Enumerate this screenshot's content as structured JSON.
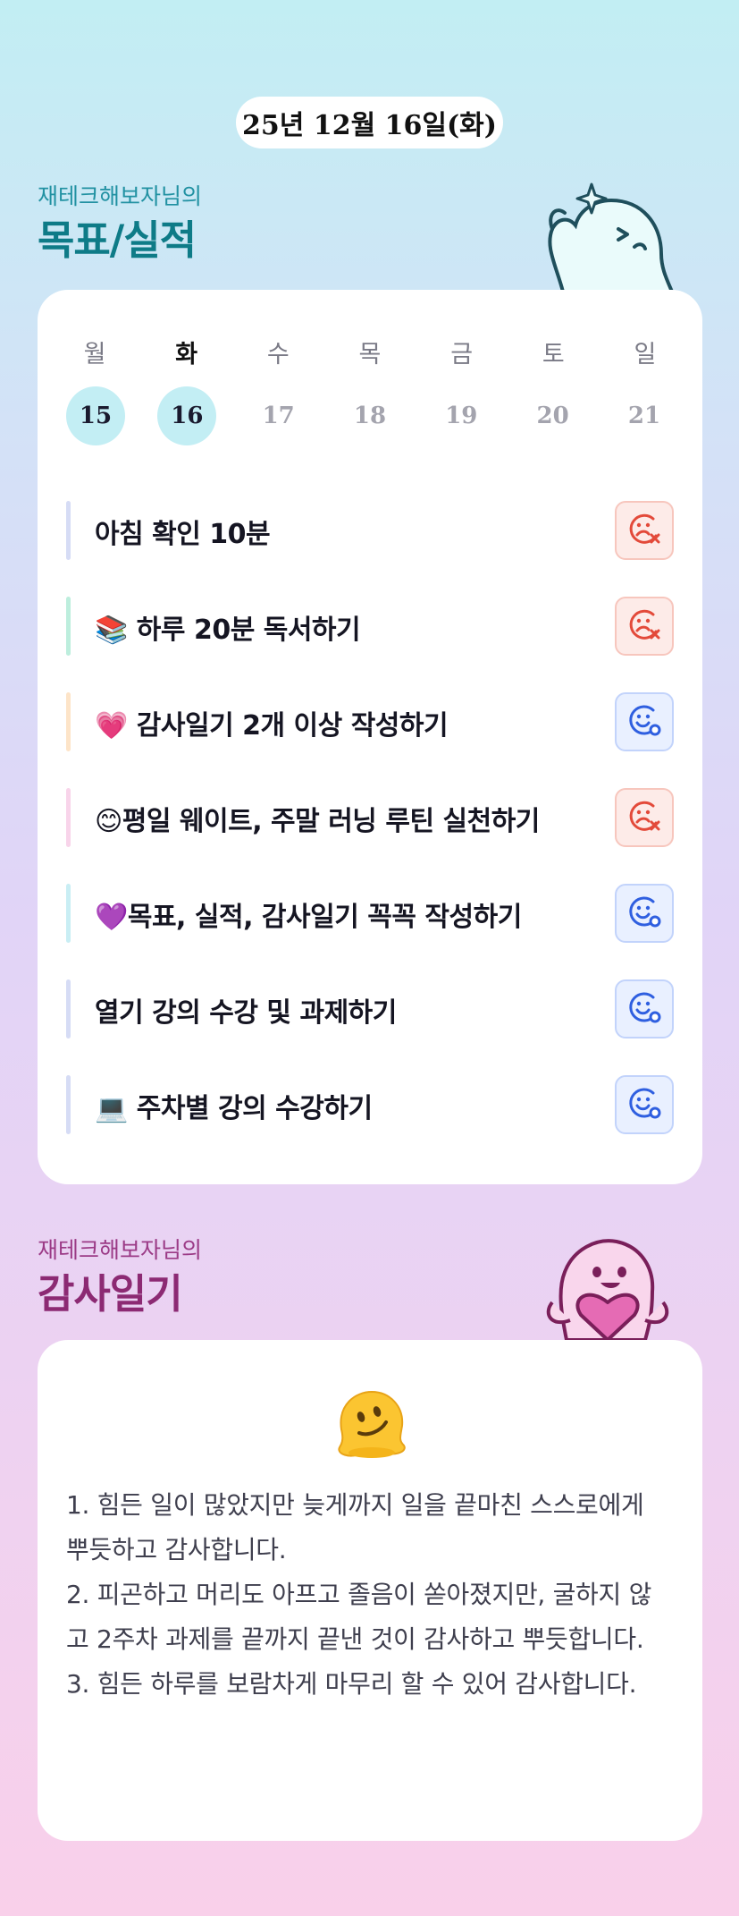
{
  "header": {
    "date": "25년 12월 16일(화)"
  },
  "goals_section": {
    "subtitle": "재테크해보자님의",
    "title": "목표/실적"
  },
  "week": {
    "days": [
      {
        "label": "월",
        "date": "15",
        "today": false,
        "active": true
      },
      {
        "label": "화",
        "date": "16",
        "today": true,
        "active": true
      },
      {
        "label": "수",
        "date": "17",
        "today": false,
        "active": false
      },
      {
        "label": "목",
        "date": "18",
        "today": false,
        "active": false
      },
      {
        "label": "금",
        "date": "19",
        "today": false,
        "active": false
      },
      {
        "label": "토",
        "date": "20",
        "today": false,
        "active": false
      },
      {
        "label": "일",
        "date": "21",
        "today": false,
        "active": false
      }
    ]
  },
  "goals": [
    {
      "text": "아침 확인 10분",
      "status": "fail",
      "status_icon": "sad-face-x-icon",
      "bar_color": "#d6dcf5"
    },
    {
      "text": "📚 하루 20분 독서하기",
      "status": "fail",
      "status_icon": "sad-face-x-icon",
      "bar_color": "#bdeedd"
    },
    {
      "text": "💗 감사일기 2개 이상 작성하기",
      "status": "done",
      "status_icon": "smile-face-check-icon",
      "bar_color": "#fde4c8"
    },
    {
      "text": "😊평일 웨이트, 주말 러닝 루틴 실천하기",
      "status": "fail",
      "status_icon": "sad-face-x-icon",
      "bar_color": "#f8d4ea"
    },
    {
      "text": "💜목표, 실적, 감사일기 꼭꼭 작성하기",
      "status": "done",
      "status_icon": "smile-face-check-icon",
      "bar_color": "#c9eef4"
    },
    {
      "text": "열기 강의 수강 및 과제하기",
      "status": "done",
      "status_icon": "smile-face-check-icon",
      "bar_color": "#d6dcf5"
    },
    {
      "text": "💻 주차별 강의 수강하기",
      "status": "done",
      "status_icon": "smile-face-check-icon",
      "bar_color": "#d6dcf5"
    }
  ],
  "gratitude_section": {
    "subtitle": "재테크해보자님의",
    "title": "감사일기"
  },
  "gratitude": {
    "emoji_icon": "melting-face-icon",
    "entries": [
      "1. 힘든 일이 많았지만 늦게까지 일을 끝마친 스스로에게 뿌듯하고 감사합니다.",
      "2. 피곤하고 머리도 아프고 졸음이 쏟아졌지만, 굴하지 않고 2주차 과제를 끝까지 끝낸 것이 감사하고 뿌듯합니다.",
      "3. 힘든 하루를 보람차게 마무리 할 수 있어 감사합니다."
    ]
  },
  "colors": {
    "fail": "#e34a3a",
    "done": "#2f5fe0",
    "goal_title": "#0e7b87",
    "gratitude_title": "#8c2a73"
  }
}
